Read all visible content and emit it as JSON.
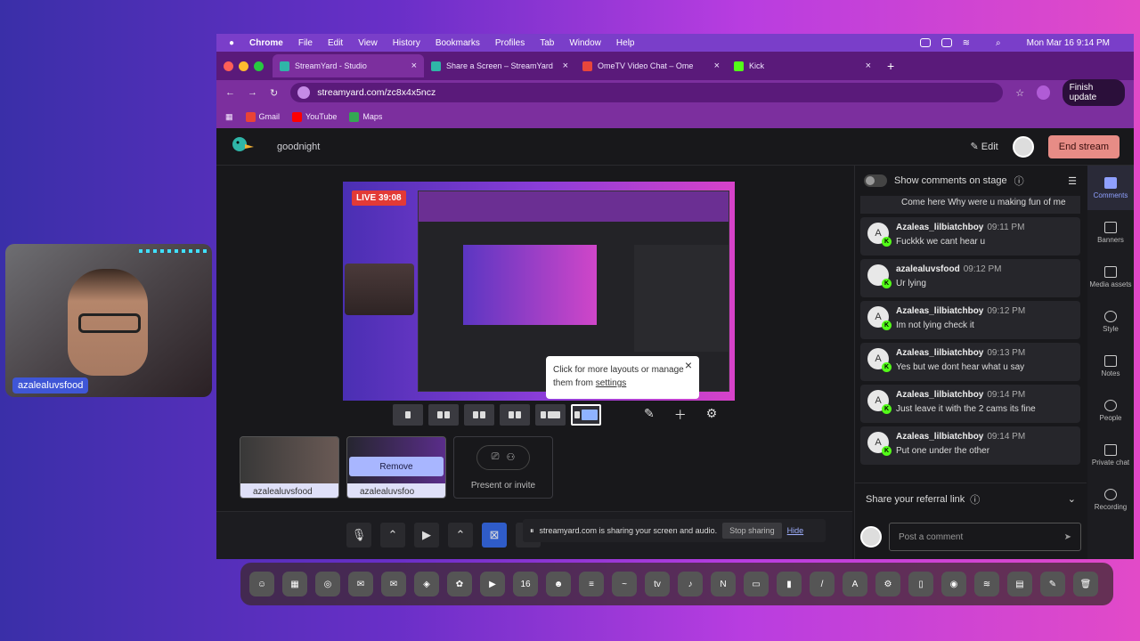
{
  "menubar": {
    "app": "Chrome",
    "items": [
      "File",
      "Edit",
      "View",
      "History",
      "Bookmarks",
      "Profiles",
      "Tab",
      "Window",
      "Help"
    ],
    "clock": "Mon Mar 16  9:14 PM"
  },
  "tabs": [
    {
      "label": "StreamYard - Studio",
      "active": true
    },
    {
      "label": "Share a Screen – StreamYard"
    },
    {
      "label": "OmeTV Video Chat – Ome"
    },
    {
      "label": "Kick"
    }
  ],
  "address": {
    "url": "streamyard.com/zc8x4x5ncz",
    "finish": "Finish update"
  },
  "bookmarks": [
    {
      "label": "Gmail"
    },
    {
      "label": "YouTube"
    },
    {
      "label": "Maps"
    }
  ],
  "header": {
    "title": "goodnight",
    "edit": "Edit",
    "end": "End stream"
  },
  "stage": {
    "live": "LIVE 39:08"
  },
  "tooltip": {
    "text": "Click for more layouts or manage them from ",
    "link": "settings"
  },
  "thumbs": [
    {
      "label": "azalealuvsfood"
    },
    {
      "label": "azalealuvsfoo",
      "remove": "Remove"
    }
  ],
  "present": {
    "label": "Present or invite"
  },
  "sharebar": {
    "text": "streamyard.com is sharing your screen and audio.",
    "stop": "Stop sharing",
    "hide": "Hide"
  },
  "comments": {
    "toggle": "Show comments on stage",
    "first": "Come here Why were u making fun of me",
    "list": [
      {
        "name": "Azaleas_lilbiatchboy",
        "time": "09:11 PM",
        "text": "Fuckkk we cant hear u",
        "initial": "A"
      },
      {
        "name": "azalealuvsfood",
        "time": "09:12 PM",
        "text": "Ur lying",
        "initial": ""
      },
      {
        "name": "Azaleas_lilbiatchboy",
        "time": "09:12 PM",
        "text": "Im not lying check it",
        "initial": "A"
      },
      {
        "name": "Azaleas_lilbiatchboy",
        "time": "09:13 PM",
        "text": "Yes but we dont hear what u say",
        "initial": "A"
      },
      {
        "name": "Azaleas_lilbiatchboy",
        "time": "09:14 PM",
        "text": "Just leave it with the 2 cams its fine",
        "initial": "A"
      },
      {
        "name": "Azaleas_lilbiatchboy",
        "time": "09:14 PM",
        "text": "Put one under the other",
        "initial": "A"
      }
    ],
    "referral": "Share your referral link",
    "post_placeholder": "Post a comment"
  },
  "rightnav": [
    {
      "label": "Comments",
      "active": true
    },
    {
      "label": "Banners"
    },
    {
      "label": "Media assets"
    },
    {
      "label": "Style"
    },
    {
      "label": "Notes"
    },
    {
      "label": "People"
    },
    {
      "label": "Private chat"
    },
    {
      "label": "Recording"
    }
  ],
  "dock": {
    "calendar_day": "16"
  },
  "webcam": {
    "label": "azalealuvsfood"
  }
}
